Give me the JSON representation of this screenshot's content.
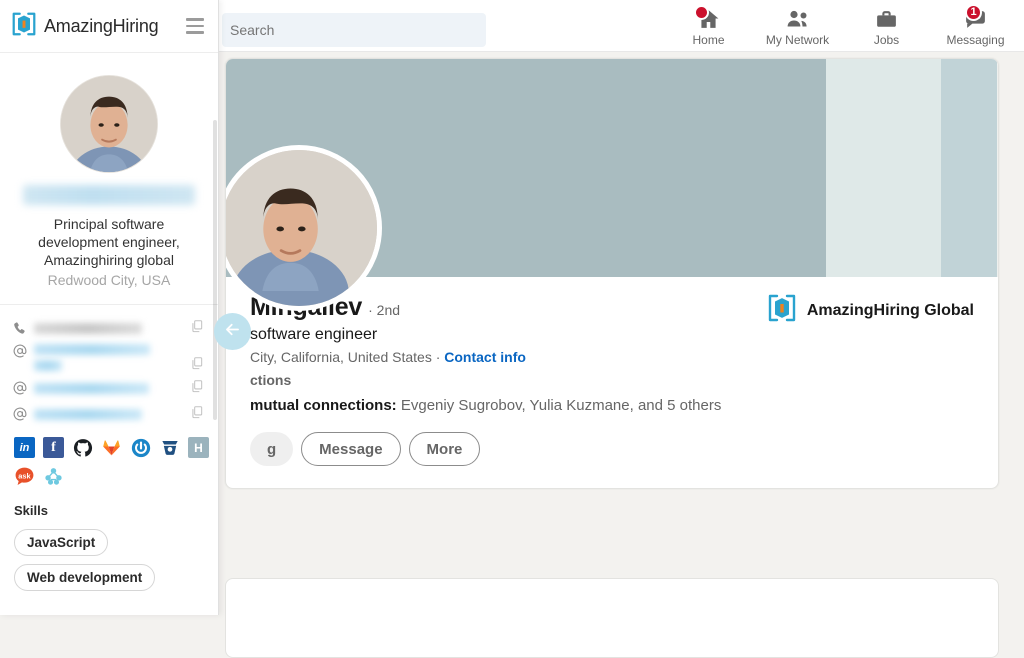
{
  "topnav": {
    "search": {
      "value": "",
      "placeholder": "Search",
      "visible_text": "earch"
    },
    "items": [
      {
        "label": "Home",
        "icon": "home-icon",
        "badge": "",
        "badge_type": "dot"
      },
      {
        "label": "My Network",
        "icon": "people-icon",
        "badge": "",
        "badge_type": "none"
      },
      {
        "label": "Jobs",
        "icon": "briefcase-icon",
        "badge": "",
        "badge_type": "none"
      },
      {
        "label": "Messaging",
        "icon": "message-icon",
        "badge": "1",
        "badge_type": "count"
      }
    ],
    "badge_color": "#cb112d"
  },
  "profile": {
    "name": "Mingaliev",
    "degree": "· 2nd",
    "headline": "software engineer",
    "location": "City, California, United States ·",
    "contact_info_label": "Contact info",
    "connections": "ctions",
    "mutuals_prefix": "mutual connections:",
    "mutuals_names": "Evgeniy Sugrobov, Yulia Kuzmane, and 5 others",
    "buttons": [
      {
        "label": "g",
        "style": "ghost"
      },
      {
        "label": "Message",
        "style": "outline"
      },
      {
        "label": "More",
        "style": "outline"
      }
    ],
    "company": "AmazingHiring Global",
    "cover_colors": [
      "#a9bcc0",
      "#dfe9e8",
      "#c1d3d7"
    ],
    "link_color": "#0a66c2"
  },
  "sidebar": {
    "brand": "AmazingHiring",
    "menu_icon": "hamburger-icon",
    "name_redacted": true,
    "title": "Principal software development engineer, Amazinghiring global",
    "location": "Redwood City, USA",
    "contacts": [
      {
        "icon": "phone-icon",
        "redacted": true,
        "color": "gray",
        "copy": "copy-icon"
      },
      {
        "icon": "at-icon",
        "redacted": true,
        "color": "blue",
        "copy": "copy-icon"
      },
      {
        "icon": "at-icon",
        "redacted": true,
        "color": "blue",
        "copy": "copy-icon"
      },
      {
        "icon": "at-icon",
        "redacted": true,
        "color": "blue",
        "copy": "copy-icon"
      }
    ],
    "socials": [
      {
        "name": "linkedin-icon",
        "bg": "#0a66c2",
        "glyph": "in"
      },
      {
        "name": "facebook-icon",
        "bg": "#3b5998",
        "glyph": "f"
      },
      {
        "name": "github-icon",
        "bg": "#1b1f23",
        "glyph": ""
      },
      {
        "name": "gitlab-icon",
        "bg": "#ffffff",
        "glyph": ""
      },
      {
        "name": "power-icon",
        "bg": "#ffffff",
        "glyph": ""
      },
      {
        "name": "bitbucket-icon",
        "bg": "#ffffff",
        "glyph": ""
      },
      {
        "name": "hackerrank-icon",
        "bg": "#9bb3bd",
        "glyph": "H"
      },
      {
        "name": "askfm-icon",
        "bg": "#e8512a",
        "glyph": "ask"
      },
      {
        "name": "habr-icon",
        "bg": "#ffffff",
        "glyph": ""
      }
    ],
    "skills_heading": "Skills",
    "skills": [
      "JavaScript",
      "Web development"
    ],
    "back_button": "back-arrow-icon"
  }
}
